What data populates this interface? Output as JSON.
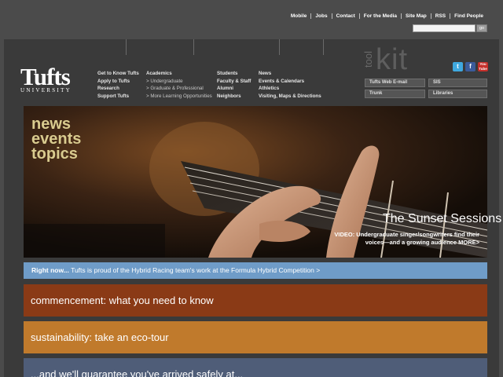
{
  "utility_links": [
    "Mobile",
    "Jobs",
    "Contact",
    "For the Media",
    "Site Map",
    "RSS",
    "Find People"
  ],
  "search": {
    "go_label": "go"
  },
  "logo": {
    "main": "Tufts",
    "sub": "UNIVERSITY"
  },
  "nav": {
    "col1": [
      "Get to Know Tufts",
      "Apply to Tufts",
      "Research",
      "Support Tufts"
    ],
    "col2": {
      "head": "Academics",
      "items": [
        "> Undergraduate",
        "> Graduate & Professional",
        "> More Learning Opportunities"
      ]
    },
    "col3": [
      "Students",
      "Faculty & Staff",
      "Alumni",
      "Neighbors"
    ],
    "col4": [
      "News",
      "Events & Calendars",
      "Athletics",
      "Visiting, Maps & Directions"
    ]
  },
  "toolkit": {
    "tool": "tool",
    "kit": "kit",
    "buttons": [
      "Tufts Web E-mail",
      "SIS",
      "Trunk",
      "Libraries"
    ]
  },
  "social": {
    "twitter": "t",
    "facebook": "f",
    "youtube": "You Tube"
  },
  "hero": {
    "words": [
      "news",
      "events",
      "topics"
    ],
    "title": "The Sunset Sessions",
    "caption": "VIDEO: Undergraduate singer/songwriters find their voices—and a growing audience  MORE>"
  },
  "right_now": {
    "label": "Right now...",
    "text": "Tufts is proud of the Hybrid Racing team's work at the Formula Hybrid Competition  >"
  },
  "rows": [
    {
      "label": "commencement: what you need to know",
      "color": "#8a3a16"
    },
    {
      "label": "sustainability: take an eco-tour",
      "color": "#c07a2c"
    },
    {
      "label": "...and we'll guarantee you've arrived safely at...",
      "color": "#4f5d78"
    }
  ],
  "colors": {
    "panel": "#3a3a3a",
    "page": "#4b4b4b",
    "accent_blue": "#6f9cc8"
  }
}
